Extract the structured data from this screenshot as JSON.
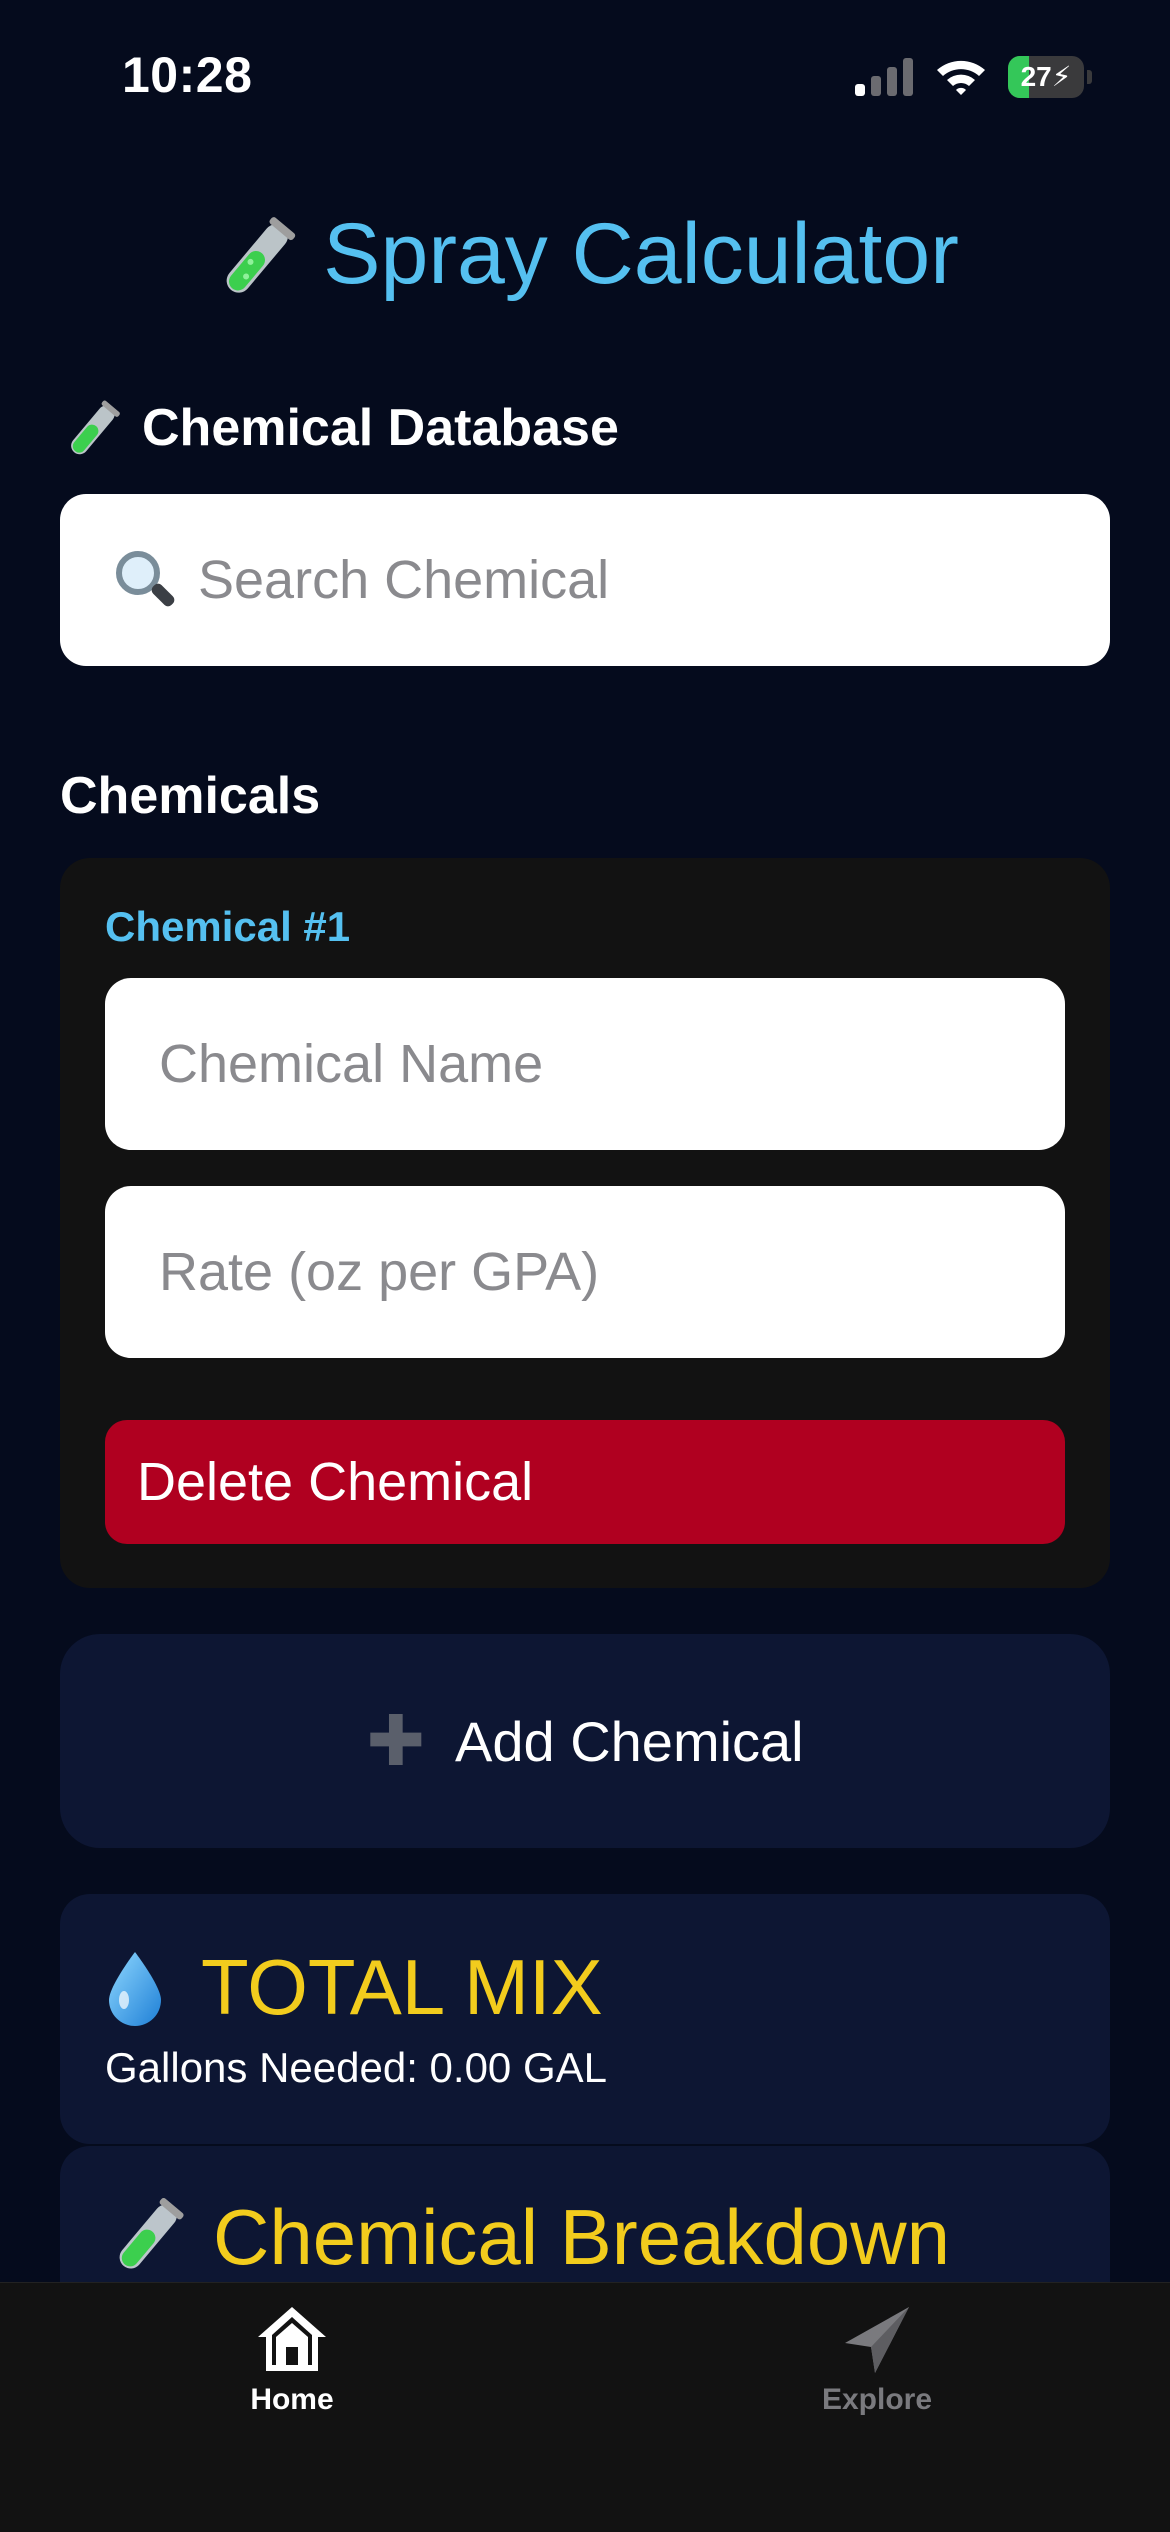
{
  "status_bar": {
    "time": "10:28",
    "battery_percent": "27",
    "battery_level": 0.27
  },
  "app": {
    "title": "Spray Calculator",
    "title_icon": "test-tube-icon",
    "accent_color": "#55c0f0"
  },
  "database": {
    "heading": "Chemical Database",
    "heading_icon": "test-tube-icon",
    "search_icon": "magnifying-glass-icon",
    "search_placeholder": "Search Chemical",
    "search_value": ""
  },
  "chemicals": {
    "heading": "Chemicals",
    "items": [
      {
        "label": "Chemical #1",
        "name_placeholder": "Chemical Name",
        "name_value": "",
        "rate_placeholder": "Rate (oz per GPA)",
        "rate_value": "",
        "delete_label": "Delete Chemical"
      }
    ],
    "add_label": "Add Chemical",
    "add_icon": "plus-icon"
  },
  "total_mix": {
    "title": "TOTAL MIX",
    "icon": "droplet-icon",
    "gallons_text": "Gallons Needed: 0.00 GAL"
  },
  "breakdown": {
    "title": "Chemical Breakdown",
    "icon": "test-tube-icon"
  },
  "tabs": [
    {
      "label": "Home",
      "icon": "house-icon",
      "active": true
    },
    {
      "label": "Explore",
      "icon": "paper-plane-icon",
      "active": false
    }
  ],
  "colors": {
    "background": "#050b1d",
    "card": "#121212",
    "panel": "#0d1633",
    "danger": "#b00020",
    "highlight": "#f2cc1d"
  }
}
